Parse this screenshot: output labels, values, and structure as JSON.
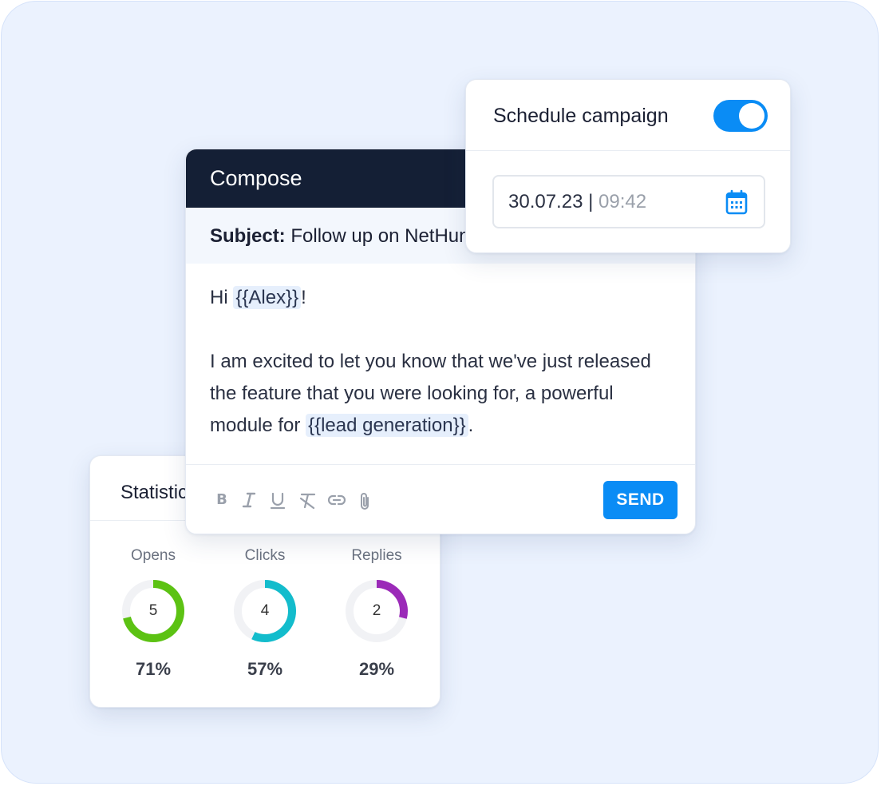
{
  "stats": {
    "title": "Statistics",
    "items": [
      {
        "label": "Opens",
        "value": "5",
        "percent": "71%",
        "fraction": 0.71,
        "color": "#5cc213"
      },
      {
        "label": "Clicks",
        "value": "4",
        "percent": "57%",
        "fraction": 0.57,
        "color": "#13bccc"
      },
      {
        "label": "Replies",
        "value": "2",
        "percent": "29%",
        "fraction": 0.29,
        "color": "#9b2ab8"
      }
    ]
  },
  "compose": {
    "title": "Compose",
    "subject_label": "Subject:",
    "subject_value": "Follow up on NetHunt",
    "greeting": "Hi",
    "name_tag": "{{Alex}}",
    "greeting_end": "!",
    "body_line": "I am excited to let you know that we've just released the feature that you were looking for, a powerful module for",
    "feature_tag": "{{lead generation}}",
    "body_end": ".",
    "toolbar": {
      "bold": "B",
      "italic": "bold-icon",
      "icons": [
        "bold-icon",
        "italic-icon",
        "underline-icon",
        "clear-format-icon",
        "link-icon",
        "attachment-icon"
      ]
    },
    "send_label": "SEND"
  },
  "schedule": {
    "title": "Schedule campaign",
    "toggle_on": true,
    "date": "30.07.23",
    "separator": "|",
    "time": "09:42",
    "icon": "calendar-icon",
    "accent": "#0a8cf5"
  }
}
